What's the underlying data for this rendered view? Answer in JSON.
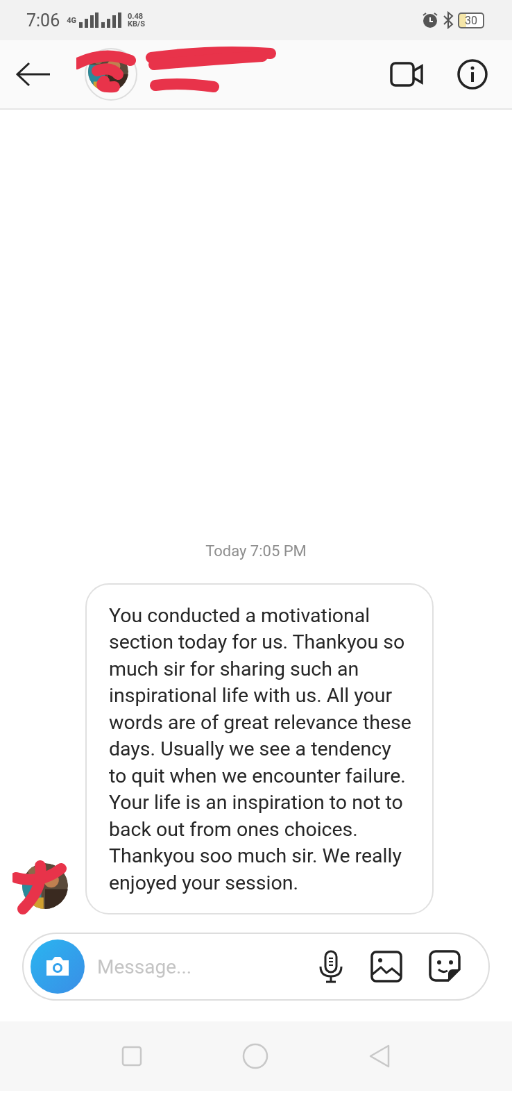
{
  "status_bar": {
    "time": "7:06",
    "network": "4G",
    "speed": "0.48",
    "speed_unit": "KB/S",
    "battery": "30"
  },
  "chat": {
    "timestamp": "Today 7:05 PM",
    "messages": [
      {
        "text": "You conducted a motivational section today for us. Thankyou so much sir for sharing such an inspirational life with us. All your words are of great relevance these days. Usually we see a tendency to quit when we encounter failure. Your life is an inspiration to not to back out from ones choices. Thankyou soo much sir. We really enjoyed your session."
      }
    ]
  },
  "composer": {
    "placeholder": "Message..."
  }
}
